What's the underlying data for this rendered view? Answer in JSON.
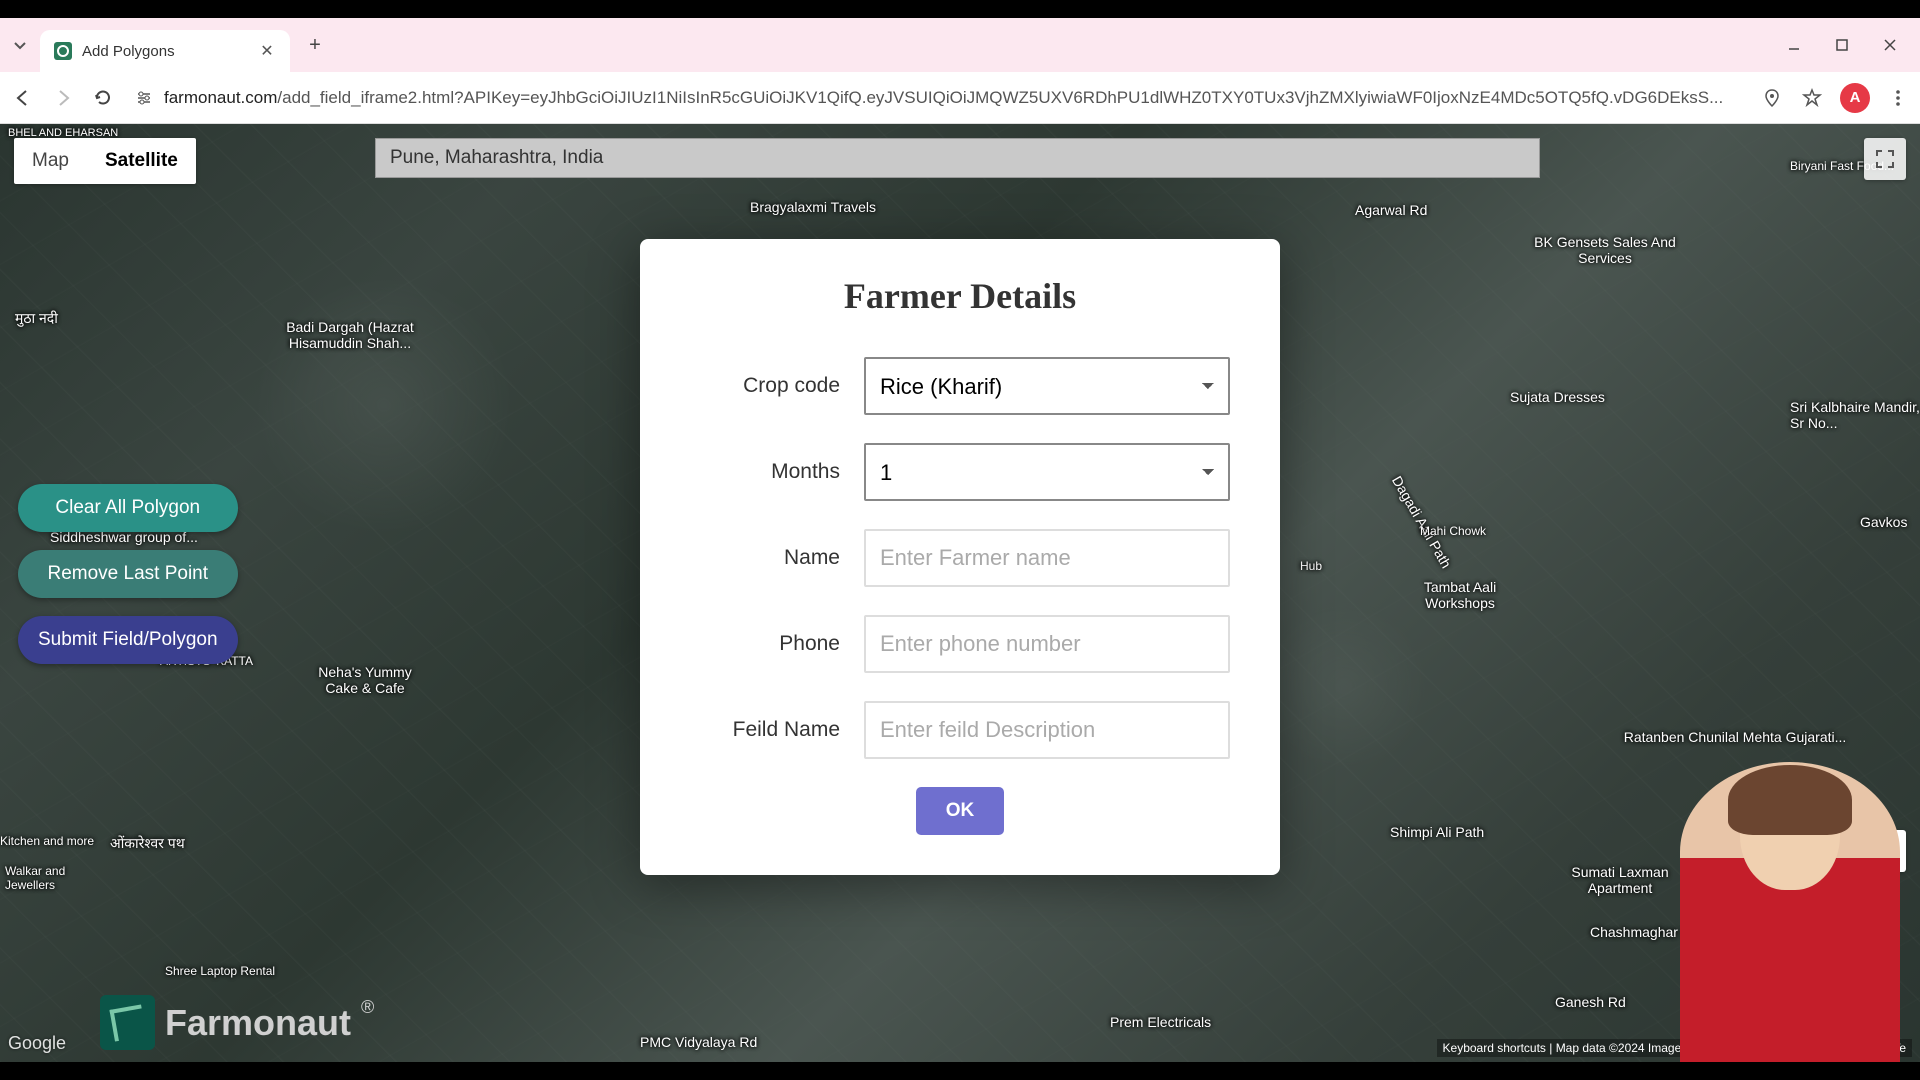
{
  "browser": {
    "tab_title": "Add Polygons",
    "url_domain": "farmonaut.com",
    "url_path": "/add_field_iframe2.html?APIKey=eyJhbGciOiJIUzI1NiIsInR5cGUiOiJKV1QifQ.eyJVSUIQiOiJMQWZ5UXV6RDhPU1dlWHZ0TXY0TUx3VjhZMXlyiwiaWF0IjoxNzE4MDc5OTQ5fQ.vDG6DEksS...",
    "profile_letter": "A"
  },
  "map": {
    "type_map": "Map",
    "type_satellite": "Satellite",
    "search_value": "Pune, Maharashtra, India",
    "attribution": "Keyboard shortcuts | Map data ©2024 Imagery ©2024 Airbus, CNES / Airbus, Maxar Te",
    "google": "Google",
    "labels": {
      "l1": "BHEL AND EHARSAN",
      "l2": "Bragyalaxmi Travels",
      "l3": "Badi Dargah (Hazrat Hisamuddin Shah...",
      "l4": "मुठा नदी",
      "l5": "Siddheshwar group of...",
      "l6": "ARTISTS' KATTA",
      "l7": "Neha's Yummy Cake & Cafe",
      "l8": "ओंकारेश्वर पथ",
      "l9": "Walkar and Jewellers",
      "l10": "Kitchen and more",
      "l11": "Shree Laptop Rental",
      "l12": "Agarwal Rd",
      "l13": "BK Gensets Sales And Services",
      "l14": "Sujata Dresses",
      "l15": "Sri Kalbhaire Mandir, Sr No...",
      "l16": "Tambat Aali Workshops",
      "l17": "Gavkos",
      "l18": "Ratanben Chunilal Mehta Gujarati...",
      "l19": "Sumati Laxman Apartment",
      "l20": "Chashmaghar Optician",
      "l21": "Ganesh Rd",
      "l22": "Shimpi Ali Path",
      "l23": "Prem Electricals",
      "l24": "PMC Vidyalaya Rd",
      "l25": "Dagadi Aali Path",
      "l26": "Mahi Chowk",
      "l27": "Biryani Fast Food...",
      "l28": "Hub"
    }
  },
  "side_buttons": {
    "clear": "Clear All Polygon",
    "remove": "Remove Last Point",
    "submit": "Submit Field/Polygon"
  },
  "logo": {
    "text": "Farmonaut",
    "registered": "®"
  },
  "modal": {
    "title": "Farmer Details",
    "crop_label": "Crop code",
    "crop_value": "Rice (Kharif)",
    "months_label": "Months",
    "months_value": "1",
    "name_label": "Name",
    "name_placeholder": "Enter Farmer name",
    "phone_label": "Phone",
    "phone_placeholder": "Enter phone number",
    "field_label": "Feild Name",
    "field_placeholder": "Enter feild Description",
    "ok": "OK"
  }
}
